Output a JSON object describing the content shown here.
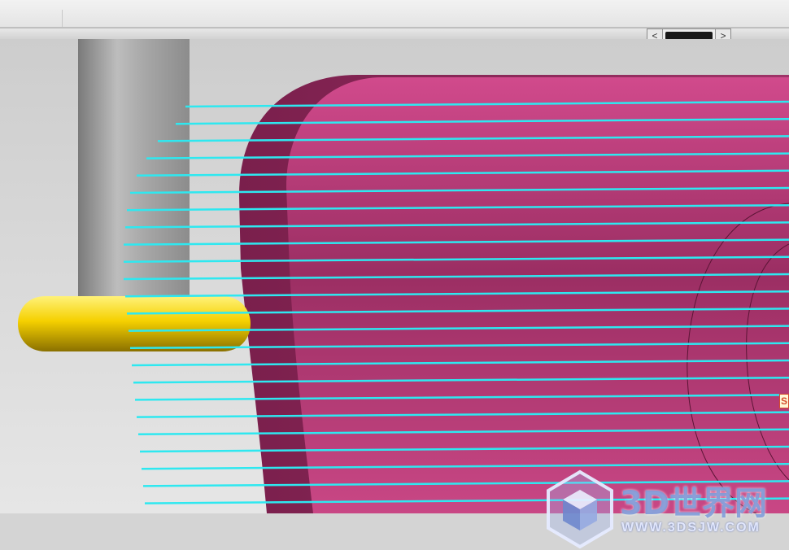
{
  "window": {
    "scroll_left_icon": "chevron-left-icon",
    "scroll_right_icon": "chevron-right-icon",
    "scroll_left_glyph": "<",
    "scroll_right_glyph": ">"
  },
  "viewport": {
    "background_color": "#d6d6d6",
    "part_color": "#c4407f",
    "toolpath_color": "#2ee8f0",
    "tool_holder_color": "#a5a5a5",
    "tool_tip_color": "#f5d000",
    "side_marker_text": "S"
  },
  "watermark": {
    "title": "3D世界网",
    "subtitle": "WWW.3DSJW.COM",
    "logo_icon": "hexagon-cube-icon"
  }
}
